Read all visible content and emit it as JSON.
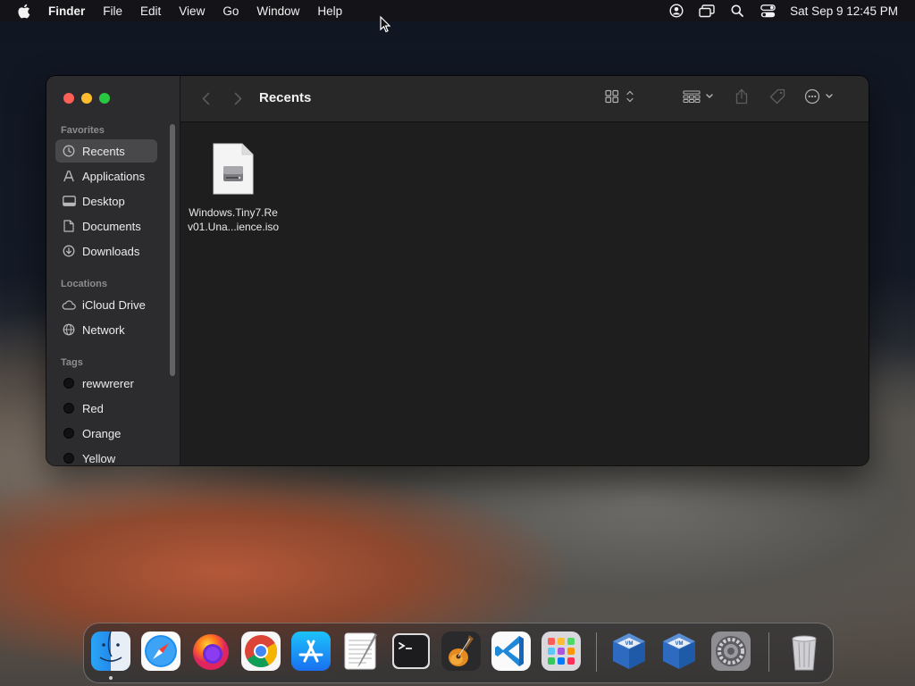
{
  "menubar": {
    "app_name": "Finder",
    "items": [
      "File",
      "Edit",
      "View",
      "Go",
      "Window",
      "Help"
    ],
    "clock": "Sat Sep 9  12:45 PM"
  },
  "window": {
    "title": "Recents",
    "sidebar": {
      "favorites_title": "Favorites",
      "favorites": [
        {
          "label": "Recents",
          "icon": "clock-icon"
        },
        {
          "label": "Applications",
          "icon": "applications-icon"
        },
        {
          "label": "Desktop",
          "icon": "desktop-icon"
        },
        {
          "label": "Documents",
          "icon": "document-icon"
        },
        {
          "label": "Downloads",
          "icon": "download-icon"
        }
      ],
      "locations_title": "Locations",
      "locations": [
        {
          "label": "iCloud Drive",
          "icon": "cloud-icon"
        },
        {
          "label": "Network",
          "icon": "globe-icon"
        }
      ],
      "tags_title": "Tags",
      "tags": [
        {
          "label": "rewwrerer"
        },
        {
          "label": "Red"
        },
        {
          "label": "Orange"
        },
        {
          "label": "Yellow"
        }
      ]
    },
    "files": [
      {
        "name_line1": "Windows.Tiny7.Re",
        "name_line2": "v01.Una...ience.iso",
        "icon": "disk-image-icon"
      }
    ]
  },
  "dock": {
    "apps": [
      "Finder",
      "Safari",
      "Firefox",
      "Chrome",
      "App Store",
      "TextEdit",
      "Terminal",
      "GarageBand",
      "Visual Studio Code",
      "Launchpad",
      "VirtualBox",
      "VirtualBox",
      "System Settings",
      "Trash"
    ]
  },
  "colors": {
    "accent_red": "#fe5f57",
    "accent_yellow": "#febc2e",
    "accent_green": "#28c840",
    "selection": "#48484a"
  }
}
